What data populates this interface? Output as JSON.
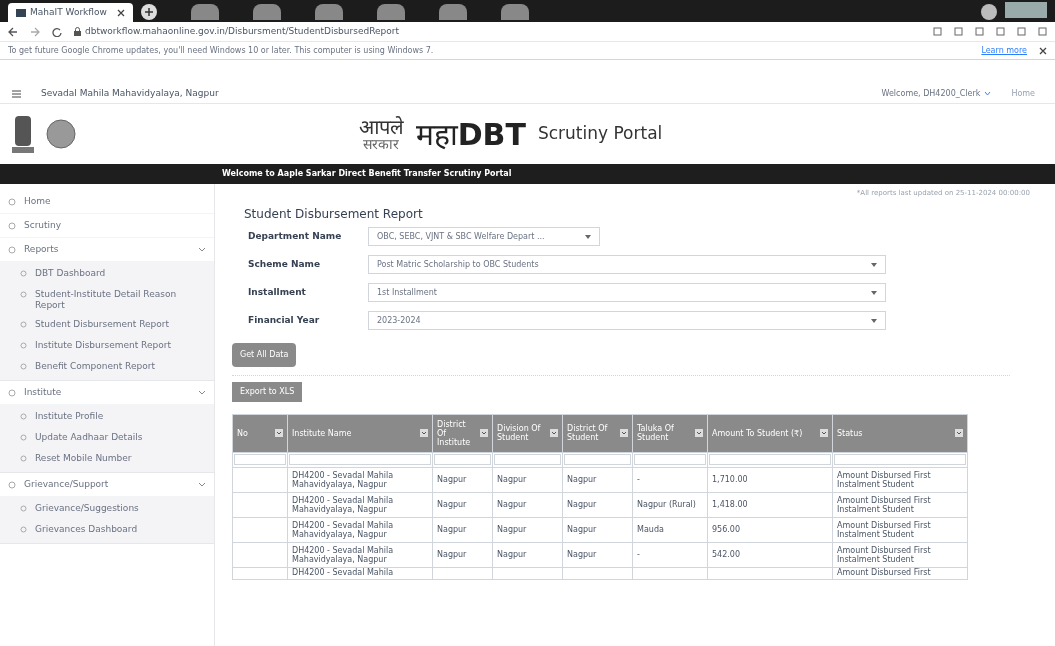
{
  "browser": {
    "tab_title": "MahaIT Workflow",
    "url": "dbtworkflow.mahaonline.gov.in/Disbursment/StudentDisbursedReport",
    "infobar": "To get future Google Chrome updates, you'll need Windows 10 or later. This computer is using Windows 7.",
    "infobar_link": "Learn more"
  },
  "header": {
    "institute": "Sevadal Mahila Mahavidyalaya, Nagpur",
    "welcome": "Welcome, DH4200_Clerk",
    "home": "Home"
  },
  "logo": {
    "marathi_top": "आपले",
    "marathi_bottom": "सरकार",
    "maha": "महा",
    "dbt": "DBT",
    "portal": "Scrutiny Portal"
  },
  "banner": "Welcome to Aaple Sarkar Direct Benefit Transfer Scrutiny Portal",
  "sidebar": {
    "items": [
      {
        "kind": "link",
        "label": "Home"
      },
      {
        "kind": "link",
        "label": "Scrutiny"
      },
      {
        "kind": "group",
        "label": "Reports",
        "expanded": true,
        "children": [
          {
            "label": "DBT Dashboard"
          },
          {
            "label": "Student-Institute Detail Reason Report"
          },
          {
            "label": "Student Disbursement Report"
          },
          {
            "label": "Institute Disbursement Report"
          },
          {
            "label": "Benefit Component Report"
          }
        ]
      },
      {
        "kind": "group",
        "label": "Institute",
        "expanded": true,
        "children": [
          {
            "label": "Institute Profile"
          },
          {
            "label": "Update Aadhaar Details"
          },
          {
            "label": "Reset Mobile Number"
          }
        ]
      },
      {
        "kind": "group",
        "label": "Grievance/Support",
        "expanded": true,
        "children": [
          {
            "label": "Grievance/Suggestions"
          },
          {
            "label": "Grievances Dashboard"
          }
        ]
      }
    ]
  },
  "updated_note": "*All reports last updated on 25-11-2024 00:00:00",
  "report_title": "Student Disbursement Report",
  "filters": [
    {
      "label": "Department Name",
      "value": "OBC, SEBC, VJNT & SBC Welfare Depart ...",
      "wide": false
    },
    {
      "label": "Scheme Name",
      "value": "Post Matric Scholarship to OBC Students",
      "wide": true
    },
    {
      "label": "Installment",
      "value": "1st Installment",
      "wide": true
    },
    {
      "label": "Financial Year",
      "value": "2023-2024",
      "wide": true
    }
  ],
  "buttons": [
    "Get All Data",
    "Export to XLS"
  ],
  "table": {
    "columns": [
      "No",
      "Institute Name",
      "District Of Institute",
      "Division Of Student",
      "District Of Student",
      "Taluka Of Student",
      "Amount To Student (₹)",
      "Status"
    ],
    "rows": [
      [
        "",
        "DH4200 - Sevadal Mahila Mahavidyalaya, Nagpur",
        "Nagpur",
        "Nagpur",
        "Nagpur",
        "-",
        "1,710.00",
        "Amount Disbursed First Instalment Student"
      ],
      [
        "",
        "DH4200 - Sevadal Mahila Mahavidyalaya, Nagpur",
        "Nagpur",
        "Nagpur",
        "Nagpur",
        "Nagpur (Rural)",
        "1,418.00",
        "Amount Disbursed First Instalment Student"
      ],
      [
        "",
        "DH4200 - Sevadal Mahila Mahavidyalaya, Nagpur",
        "Nagpur",
        "Nagpur",
        "Nagpur",
        "Mauda",
        "956.00",
        "Amount Disbursed First Instalment Student"
      ],
      [
        "",
        "DH4200 - Sevadal Mahila Mahavidyalaya, Nagpur",
        "Nagpur",
        "Nagpur",
        "Nagpur",
        "-",
        "542.00",
        "Amount Disbursed First Instalment Student"
      ],
      [
        "",
        "DH4200 - Sevadal Mahila",
        "",
        "",
        "",
        "",
        "",
        "Amount Disbursed First"
      ]
    ]
  }
}
